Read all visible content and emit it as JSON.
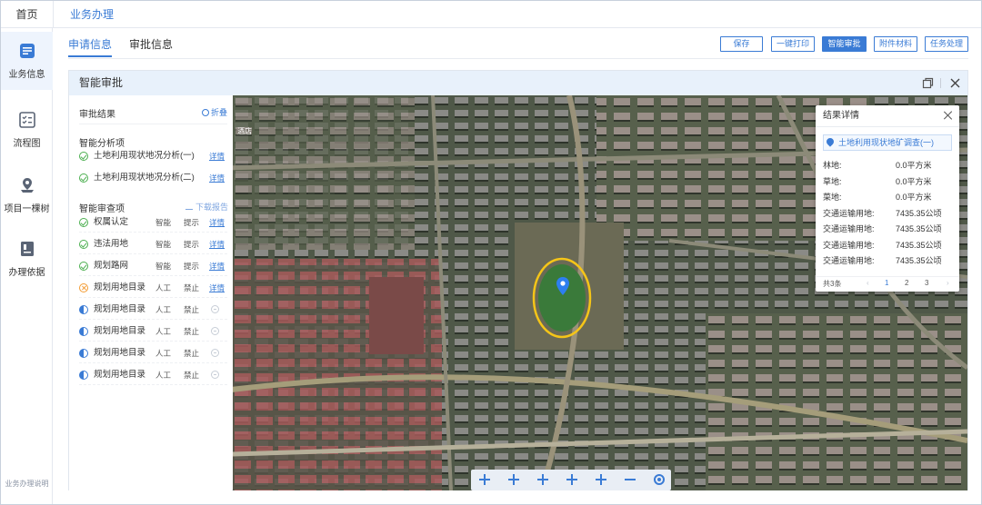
{
  "topbar": {
    "home": "首页",
    "breadcrumb": "业务办理"
  },
  "sidebar": {
    "items": [
      {
        "label": "业务信息",
        "icon": "business-info-icon"
      },
      {
        "label": "流程图",
        "icon": "flowchart-icon"
      },
      {
        "label": "项目一棵树",
        "icon": "project-tree-icon"
      },
      {
        "label": "办理依据",
        "icon": "document-basis-icon"
      }
    ],
    "footer": "业务办理说明"
  },
  "tabs": [
    {
      "label": "申请信息",
      "active": true
    },
    {
      "label": "审批信息",
      "active": false
    }
  ],
  "actions": [
    {
      "label": "保存",
      "primary": false
    },
    {
      "label": "一键打印",
      "primary": false
    },
    {
      "label": "智能审批",
      "primary": true
    },
    {
      "label": "附件材料",
      "primary": false
    },
    {
      "label": "任务处理",
      "primary": false
    }
  ],
  "panel": {
    "title": "智能审批",
    "result_title": "审批结果",
    "collapse_label": "折叠",
    "analysis_title": "智能分析项",
    "analysis_items": [
      {
        "label": "土地利用现状地况分析(一)",
        "status": "ok",
        "link": "详情"
      },
      {
        "label": "土地利用现状地况分析(二)",
        "status": "ok",
        "link": "详情"
      }
    ],
    "review_title": "智能审查项",
    "download_label": "下载报告",
    "review_items": [
      {
        "label": "权属认定",
        "mode": "智能",
        "level": "提示",
        "status": "ok",
        "link": "详情"
      },
      {
        "label": "违法用地",
        "mode": "智能",
        "level": "提示",
        "status": "ok",
        "link": "详情"
      },
      {
        "label": "规划路网",
        "mode": "智能",
        "level": "提示",
        "status": "ok",
        "link": "详情"
      },
      {
        "label": "规划用地目录",
        "mode": "人工",
        "level": "禁止",
        "status": "error",
        "link": "详情"
      },
      {
        "label": "规划用地目录",
        "mode": "人工",
        "level": "禁止",
        "status": "pending",
        "link": ""
      },
      {
        "label": "规划用地目录",
        "mode": "人工",
        "level": "禁止",
        "status": "pending",
        "link": ""
      },
      {
        "label": "规划用地目录",
        "mode": "人工",
        "level": "禁止",
        "status": "pending",
        "link": ""
      },
      {
        "label": "规划用地目录",
        "mode": "人工",
        "level": "禁止",
        "status": "pending",
        "link": ""
      }
    ]
  },
  "popup": {
    "title": "结果详情",
    "subtitle": "土地利用现状地矿调查(一)",
    "rows": [
      {
        "key": "林地:",
        "value": "0.0平方米"
      },
      {
        "key": "草地:",
        "value": "0.0平方米"
      },
      {
        "key": "菜地:",
        "value": "0.0平方米"
      },
      {
        "key": "交通运输用地:",
        "value": "7435.35公顷"
      },
      {
        "key": "交通运输用地:",
        "value": "7435.35公顷"
      },
      {
        "key": "交通运输用地:",
        "value": "7435.35公顷"
      },
      {
        "key": "交通运输用地:",
        "value": "7435.35公顷"
      }
    ],
    "pager": {
      "total": "共3条",
      "pages": [
        "1",
        "2",
        "3"
      ],
      "current": "1"
    }
  },
  "map": {
    "label_top_left": "酒店"
  },
  "colors": {
    "accent": "#3a7bd5",
    "ok": "#4caf50",
    "error": "#f39c34",
    "field": "#3a7a3a",
    "track": "#f5c518"
  }
}
